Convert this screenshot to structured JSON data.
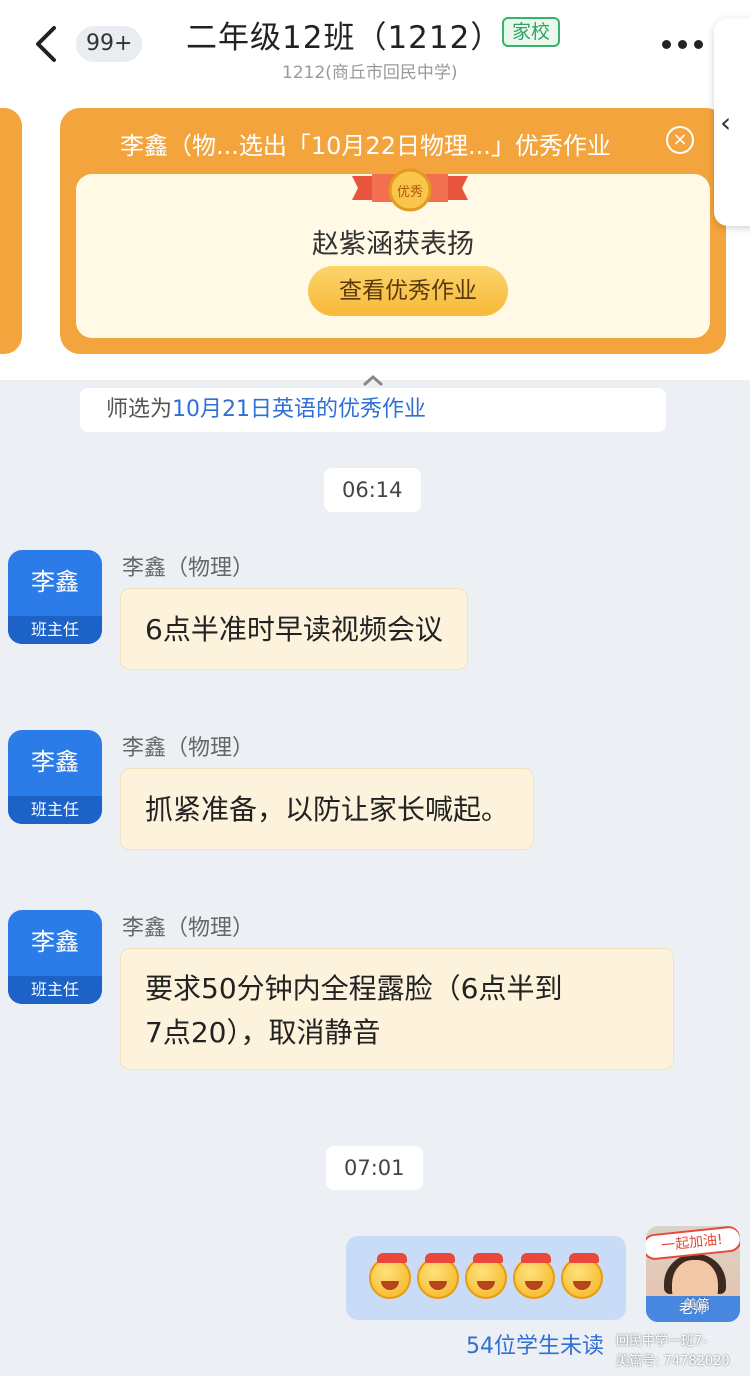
{
  "header": {
    "unread_badge": "99+",
    "title": "二年级12班（1212）",
    "tag": "家校",
    "subtitle": "1212(商丘市回民中学)"
  },
  "banner": {
    "text": "李鑫（物...选出「10月22日物理...」优秀作业",
    "ribbon_label": "优秀",
    "praise": "赵紫涵获表扬",
    "button": "查看优秀作业"
  },
  "notice": {
    "prefix": "师选为",
    "highlight": "10月21日英语的优秀作业"
  },
  "timestamps": [
    "06:14",
    "07:01"
  ],
  "messages": [
    {
      "avatar_name": "李鑫",
      "avatar_role": "班主任",
      "sender": "李鑫（物理）",
      "text": "6点半准时早读视频会议"
    },
    {
      "avatar_name": "李鑫",
      "avatar_role": "班主任",
      "sender": "李鑫（物理）",
      "text": "抓紧准备，以防让家长喊起。"
    },
    {
      "avatar_name": "李鑫",
      "avatar_role": "班主任",
      "sender": "李鑫（物理）",
      "text_line1": "要求50分钟内全程露脸（6点半到",
      "text_line2": "7点20），取消静音"
    }
  ],
  "self_message": {
    "emoji": [
      "grinning-face-emoji",
      "grinning-face-emoji",
      "grinning-face-emoji",
      "grinning-face-emoji",
      "grinning-face-emoji"
    ],
    "avatar_sticker": "一起加油!",
    "avatar_role": "老师",
    "unread_status": "54位学生未读"
  },
  "watermark": {
    "line1": "美篇",
    "line2": "回民中学一班7-",
    "line3": "美篇号: 74782020"
  },
  "colors": {
    "brand_blue": "#2b7ce9",
    "banner_orange": "#f4a43d",
    "bubble_cream": "#fdf3dc",
    "self_bubble_blue": "#c9dcf7",
    "tag_green": "#35b56b"
  }
}
